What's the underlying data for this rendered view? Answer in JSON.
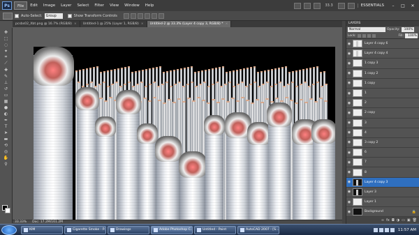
{
  "app": {
    "logo": "Ps",
    "menu": [
      "File",
      "Edit",
      "Image",
      "Layer",
      "Select",
      "Filter",
      "View",
      "Window",
      "Help"
    ],
    "zoom": "33.3",
    "workspace": "ESSENTIALS"
  },
  "options": {
    "auto_select_label": "Auto-Select:",
    "auto_select_value": "Group",
    "transform_label": "Show Transform Controls"
  },
  "tabs": [
    {
      "label": "pcsbs02_Xbt.png @ 16.7% (RGB/8)",
      "close": "×"
    },
    {
      "label": "Untitled-1 @ 25% (Layer 1, RGB/8)",
      "close": "×"
    },
    {
      "label": "Untitled-2 @ 33.3% (Layer 4 copy 3, RGB/8) *",
      "close": "×"
    }
  ],
  "status": {
    "zoom": "33.33%",
    "doc": "Doc: 17.2M/161.2M"
  },
  "layers_panel": {
    "title": "LAYERS",
    "blend_mode": "Normal",
    "opacity_label": "Opacity:",
    "opacity_value": "100%",
    "lock_label": "Lock:",
    "fill_label": "Fill:",
    "fill_value": "100%",
    "layers": [
      {
        "name": "Layer 4 copy 6",
        "selected": false,
        "dark": false,
        "cig": true
      },
      {
        "name": "Layer 4 copy 4",
        "selected": false,
        "dark": false,
        "cig": true
      },
      {
        "name": "1 copy 3",
        "selected": false,
        "dark": false,
        "cig": false
      },
      {
        "name": "1 copy 2",
        "selected": false,
        "dark": false,
        "cig": false
      },
      {
        "name": "1 copy",
        "selected": false,
        "dark": false,
        "cig": false
      },
      {
        "name": "1",
        "selected": false,
        "dark": false,
        "cig": false
      },
      {
        "name": "2",
        "selected": false,
        "dark": false,
        "cig": false
      },
      {
        "name": "2 copy",
        "selected": false,
        "dark": false,
        "cig": false
      },
      {
        "name": "3",
        "selected": false,
        "dark": false,
        "cig": false
      },
      {
        "name": "4",
        "selected": false,
        "dark": false,
        "cig": false
      },
      {
        "name": "3 copy 2",
        "selected": false,
        "dark": false,
        "cig": false
      },
      {
        "name": "6",
        "selected": false,
        "dark": false,
        "cig": false
      },
      {
        "name": "7",
        "selected": false,
        "dark": false,
        "cig": false
      },
      {
        "name": "8",
        "selected": false,
        "dark": false,
        "cig": false
      },
      {
        "name": "Layer 4 copy 3",
        "selected": true,
        "dark": true,
        "cig": true
      },
      {
        "name": "Layer 3",
        "selected": false,
        "dark": true,
        "cig": true
      },
      {
        "name": "Layer 1",
        "selected": false,
        "dark": false,
        "cig": false
      },
      {
        "name": "Background",
        "selected": false,
        "dark": true,
        "cig": false,
        "locked": true
      }
    ]
  },
  "taskbar": {
    "items": [
      "KIM",
      "Cigarette Smoke - P...",
      "Drawings",
      "Adobe Photoshop C...",
      "Untitled - Paint",
      "AutoCAD 2007 - [S..."
    ],
    "clock": "11:57 AM"
  }
}
